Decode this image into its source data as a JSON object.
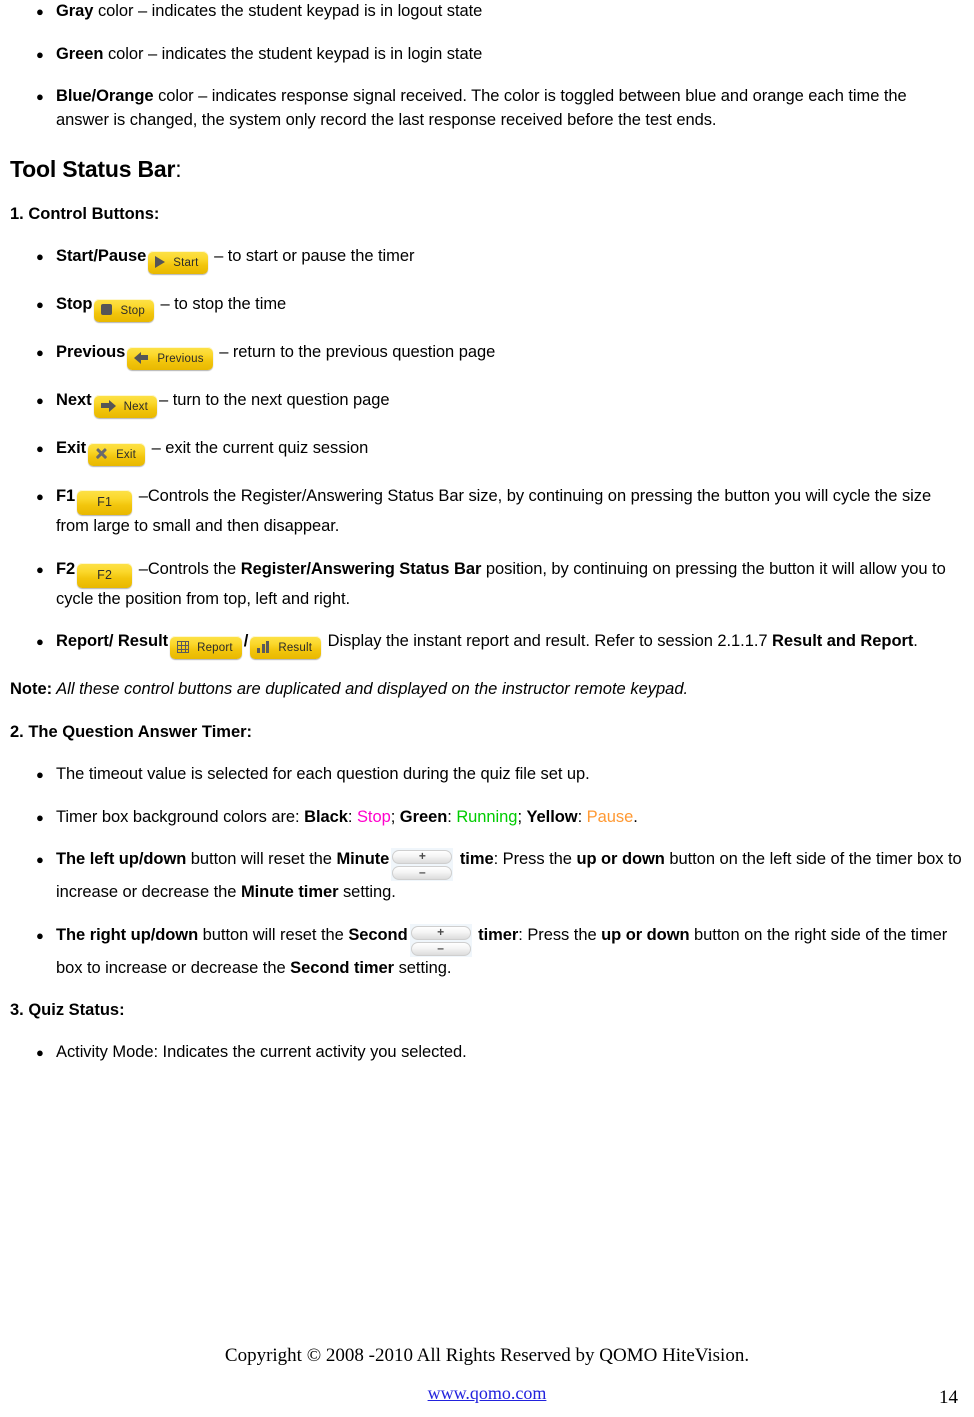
{
  "document": {
    "page_number": "14"
  },
  "keypad_color_bullets": [
    {
      "lead": "Gray",
      "rest": " color – indicates the student keypad is in logout state"
    },
    {
      "lead": "Green",
      "rest": " color – indicates the student keypad is in login state"
    },
    {
      "lead": "Blue/Orange",
      "rest": " color – indicates response signal received. The color is toggled between blue and orange each time the answer is changed, the system only record the last response received before the test ends."
    }
  ],
  "tool_status_bar": {
    "title": "Tool Status Bar",
    "title_suffix": ":",
    "control_buttons_heading": "1. Control Buttons:",
    "items": [
      {
        "label": "Start/Pause",
        "button": {
          "text": "Start",
          "icon": "play-icon"
        },
        "description": " – to start or pause the timer"
      },
      {
        "label": "Stop",
        "button": {
          "text": "Stop",
          "icon": "stop-square-icon"
        },
        "description": " – to stop the time"
      },
      {
        "label": "Previous",
        "button": {
          "text": "Previous",
          "icon": "arrow-left-icon"
        },
        "description": " – return to the previous question page"
      },
      {
        "label": "Next",
        "button": {
          "text": "Next",
          "icon": "arrow-right-icon"
        },
        "description": "– turn to the next question page"
      },
      {
        "label": "Exit",
        "button": {
          "text": "Exit",
          "icon": "close-x-icon"
        },
        "description": " – exit the current quiz session"
      }
    ],
    "f1": {
      "label": "F1",
      "button_text": "F1",
      "text_part1": " –Controls the Register/Answering Status Bar size, by continuing on pressing the button you will cycle the size from large to small and then disappear."
    },
    "f2": {
      "label": "F2",
      "button_text": "F2",
      "text_before": " –Controls the ",
      "bold_phrase": "Register/Answering Status Bar",
      "text_after": " position, by continuing on pressing the button it will allow you to cycle the position from top, left and right."
    },
    "report_result": {
      "label": "Report/ Result",
      "report_button": {
        "text": "Report",
        "icon": "grid-icon"
      },
      "separator": "/",
      "result_button": {
        "text": "Result",
        "icon": "bar-chart-icon"
      },
      "text_after_buttons": " Display the instant report and result. Refer to session ",
      "section_ref": "2.1.1.7 ",
      "bold_ref": "Result and Report",
      "period": "."
    },
    "note": {
      "label": "Note:",
      "text": " All these control buttons are duplicated and displayed on the instructor remote keypad."
    }
  },
  "question_answer_timer": {
    "heading": "2. The Question Answer Timer:",
    "bullet_timeout": "The timeout value is selected for each question during the quiz file set up.",
    "bullet_colors": {
      "prefix": "Timer box background colors are: ",
      "black_label": "Black",
      "black_sep": ": ",
      "stop_value": "Stop",
      "sep1": "; ",
      "green_label": "Green",
      "green_sep": ": ",
      "running_value": "Running",
      "sep2": "; ",
      "yellow_label": "Yellow",
      "yellow_sep": ": ",
      "pause_value": "Pause",
      "period": "."
    },
    "left_updown": {
      "bold_lead": "The left up/down",
      "text1": " button will reset the ",
      "bold_minute": "Minute",
      "stepper": {
        "plus": "+",
        "minus": "–",
        "name": "minute-stepper"
      },
      "bold_time": " time",
      "text2": ": Press the ",
      "bold_updown": "up or down",
      "text3": " button on the left side of the timer box to increase or decrease the ",
      "bold_minute_timer": "Minute timer",
      "text4": " setting."
    },
    "right_updown": {
      "bold_lead": "The right up/down",
      "text1": " button will reset the ",
      "bold_second": "Second",
      "stepper": {
        "plus": "+",
        "minus": "–",
        "name": "second-stepper"
      },
      "bold_timer": " timer",
      "text2": ": Press the ",
      "bold_updown": "up or down",
      "text3": " button on the right side of the timer box to increase or decrease the ",
      "bold_second_timer": "Second timer",
      "text4": " setting."
    }
  },
  "quiz_status": {
    "heading": "3. Quiz Status:",
    "bullet_activity": "Activity Mode: Indicates the current activity you selected."
  },
  "footer": {
    "copyright": "Copyright © 2008 -2010 All Rights Reserved by QOMO HiteVision.",
    "website": "www.qomo.com",
    "page_number": "14"
  },
  "colors": {
    "stop": "#ff00cc",
    "running": "#00cc00",
    "pause": "#ff9933",
    "button_yellow": "#f2c50c",
    "link_blue": "#2222dd"
  }
}
